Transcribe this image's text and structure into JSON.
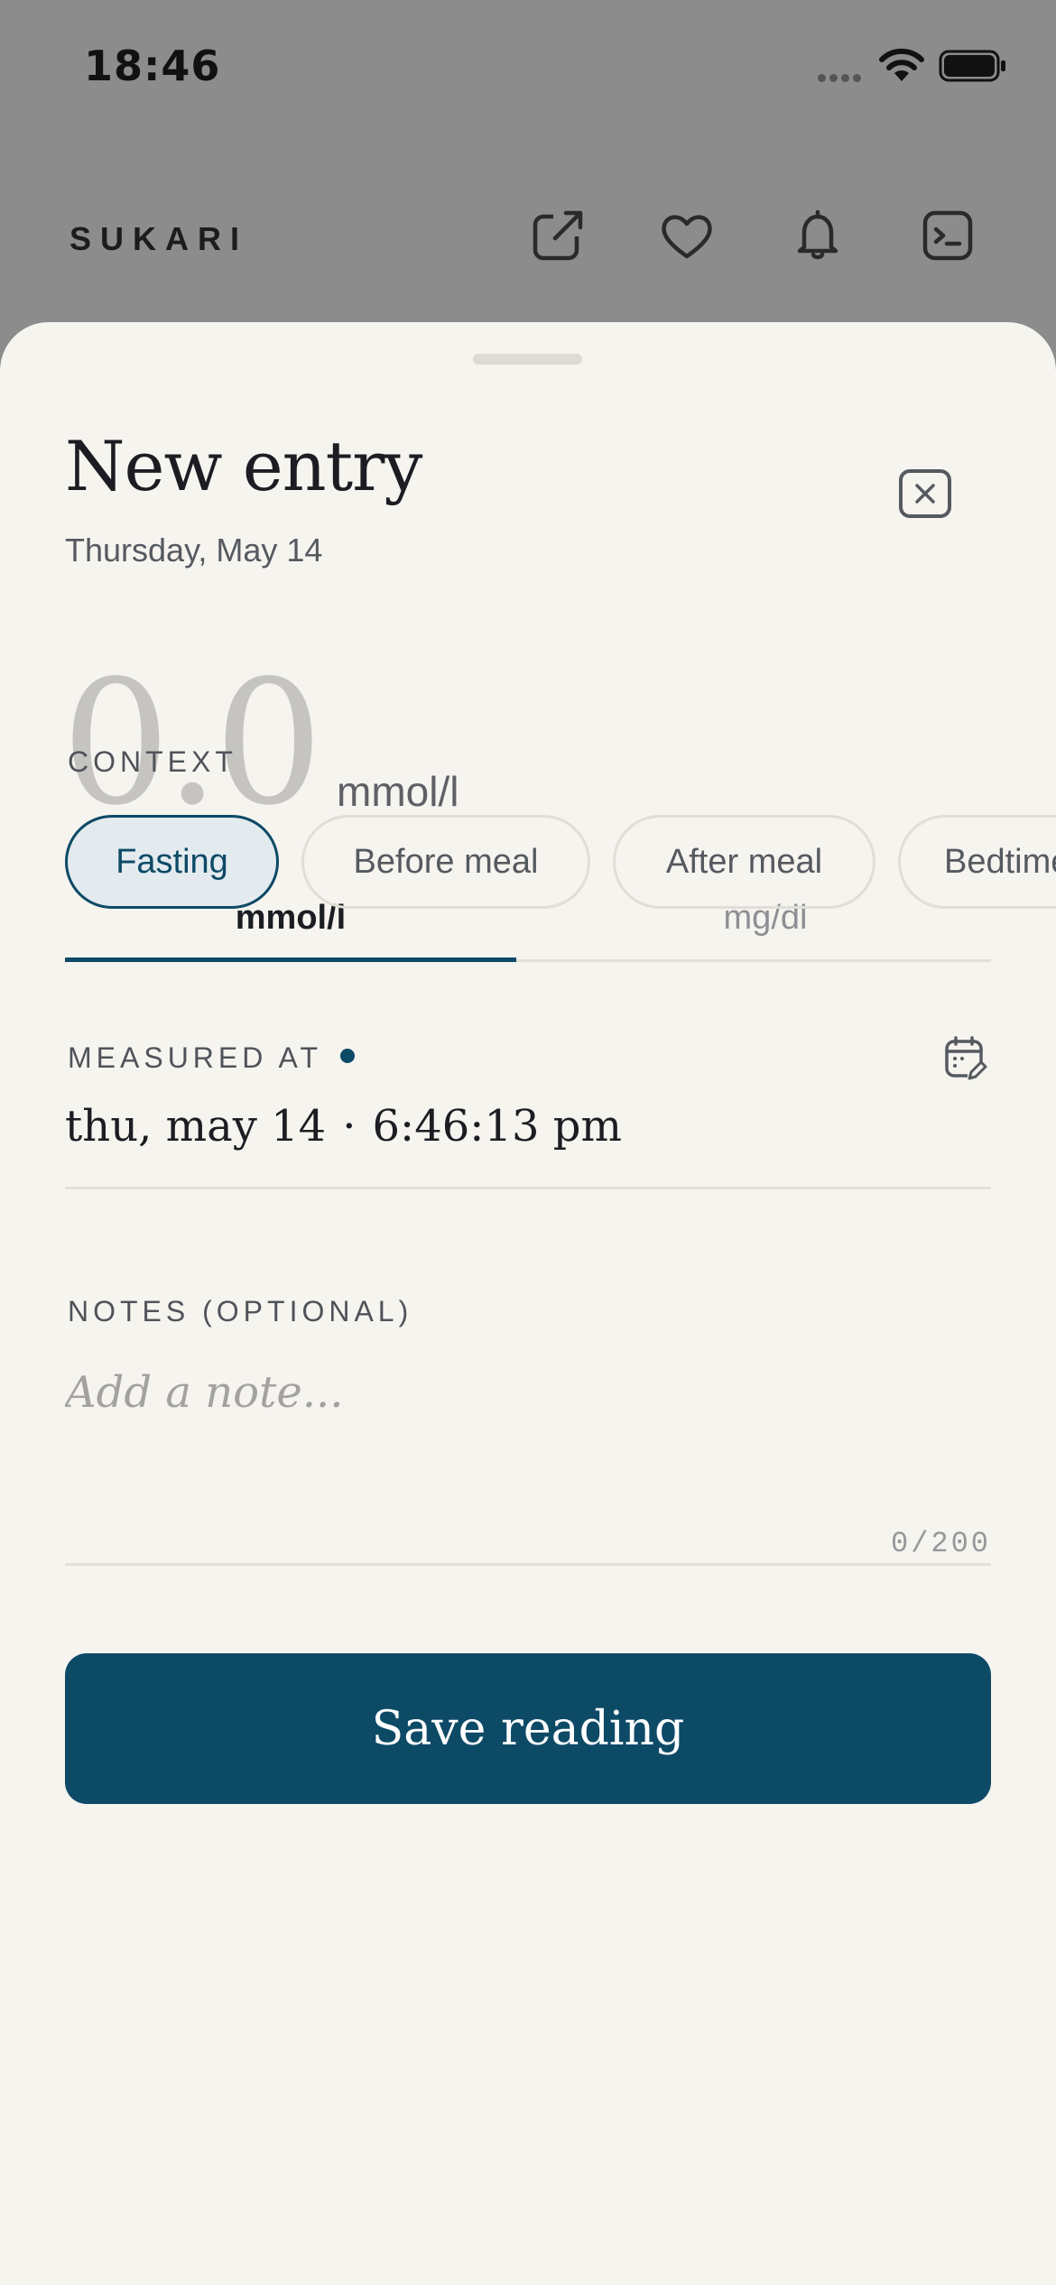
{
  "status_bar": {
    "time": "18:46"
  },
  "header": {
    "brand": "SUKARI",
    "icons": [
      "external-link-icon",
      "heart-icon",
      "bell-icon",
      "terminal-icon"
    ]
  },
  "sheet": {
    "title": "New entry",
    "subtitle": "Thursday, May 14",
    "reading": {
      "value": "0.0",
      "unit": "mmol/l"
    },
    "unit_tabs": [
      {
        "label": "mmol/l",
        "selected": true
      },
      {
        "label": "mg/dl",
        "selected": false
      }
    ],
    "context": {
      "label": "CONTEXT",
      "options": [
        {
          "label": "Fasting",
          "selected": true
        },
        {
          "label": "Before meal",
          "selected": false
        },
        {
          "label": "After meal",
          "selected": false
        },
        {
          "label": "Bedtime",
          "selected": false
        }
      ]
    },
    "measured_at": {
      "label": "MEASURED AT",
      "date": "thu, may 14",
      "separator": "·",
      "time": "6:46:13 pm"
    },
    "notes": {
      "label": "NOTES (OPTIONAL)",
      "placeholder": "Add a note...",
      "value": "",
      "counter": "0/200"
    },
    "save_label": "Save reading"
  },
  "colors": {
    "accent": "#0d4a66",
    "sheet_background": "#f6f4ef",
    "overlay_background": "#8c8c8c",
    "chip_selected_background": "#e3ebef"
  }
}
